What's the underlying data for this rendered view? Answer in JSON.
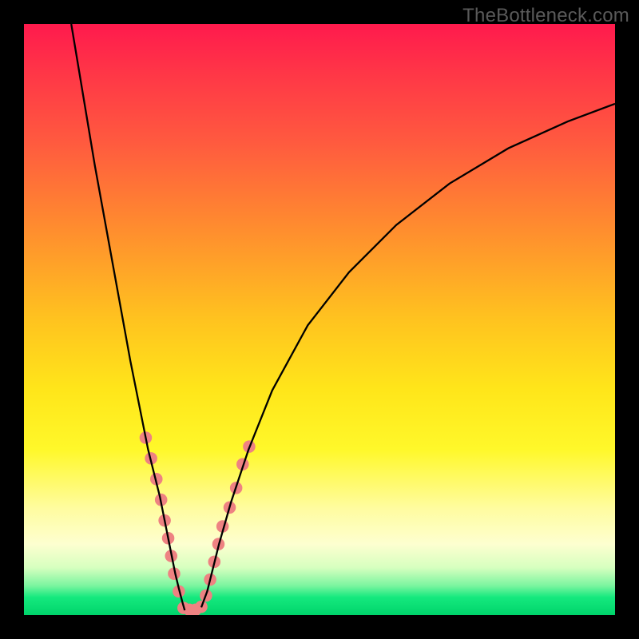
{
  "watermark": "TheBottleneck.com",
  "chart_data": {
    "type": "line",
    "title": "",
    "xlabel": "",
    "ylabel": "",
    "xlim": [
      0,
      100
    ],
    "ylim": [
      0,
      100
    ],
    "curve_left": {
      "x": [
        8,
        10,
        12,
        14,
        16,
        18,
        19,
        20,
        21,
        22,
        23,
        24,
        24.8,
        25.6,
        26.2,
        26.8,
        27.2
      ],
      "y": [
        100,
        88,
        76,
        65,
        54,
        43,
        38,
        33,
        28,
        24,
        20,
        15,
        11,
        7,
        4.5,
        2.2,
        0.8
      ]
    },
    "curve_right": {
      "x": [
        30,
        31,
        32,
        33,
        35,
        38,
        42,
        48,
        55,
        63,
        72,
        82,
        92,
        100
      ],
      "y": [
        1.3,
        4,
        8,
        12,
        19,
        28,
        38,
        49,
        58,
        66,
        73,
        79,
        83.5,
        86.5
      ]
    },
    "marker_clusters": [
      {
        "cx": 20.6,
        "cy": 30.0
      },
      {
        "cx": 21.5,
        "cy": 26.5
      },
      {
        "cx": 22.4,
        "cy": 23.0
      },
      {
        "cx": 23.2,
        "cy": 19.5
      },
      {
        "cx": 23.8,
        "cy": 16.0
      },
      {
        "cx": 24.4,
        "cy": 13.0
      },
      {
        "cx": 24.9,
        "cy": 10.0
      },
      {
        "cx": 25.4,
        "cy": 7.0
      },
      {
        "cx": 26.2,
        "cy": 4.0
      },
      {
        "cx": 27.0,
        "cy": 1.2
      },
      {
        "cx": 28.0,
        "cy": 0.9
      },
      {
        "cx": 29.0,
        "cy": 0.9
      },
      {
        "cx": 30.0,
        "cy": 1.4
      },
      {
        "cx": 30.8,
        "cy": 3.3
      },
      {
        "cx": 31.5,
        "cy": 6.0
      },
      {
        "cx": 32.2,
        "cy": 9.0
      },
      {
        "cx": 32.9,
        "cy": 12.0
      },
      {
        "cx": 33.6,
        "cy": 15.0
      },
      {
        "cx": 34.8,
        "cy": 18.2
      },
      {
        "cx": 35.9,
        "cy": 21.5
      },
      {
        "cx": 37.0,
        "cy": 25.5
      },
      {
        "cx": 38.1,
        "cy": 28.5
      }
    ],
    "marker_color": "#ee8282",
    "curve_color": "#000000",
    "marker_radius_pct": 1.05
  }
}
